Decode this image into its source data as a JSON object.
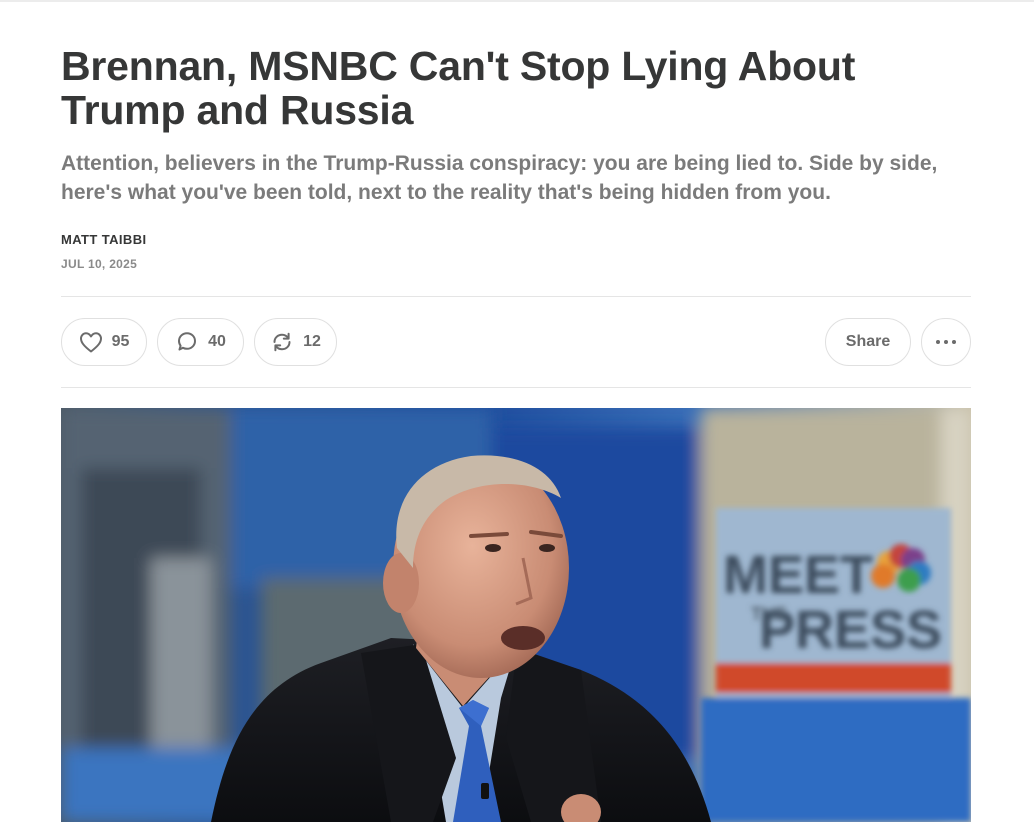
{
  "article": {
    "title": "Brennan, MSNBC Can't Stop Lying About Trump and Russia",
    "subtitle": "Attention, believers in the Trump-Russia conspiracy: you are being lied to. Side by side, here's what you've been told, next to the reality that's being hidden from you.",
    "author": "MATT TAIBBI",
    "date": "JUL 10, 2025"
  },
  "actions": {
    "likes": "95",
    "comments": "40",
    "restacks": "12",
    "share_label": "Share"
  },
  "hero": {
    "sign_text_1": "MEET",
    "sign_text_2": "THE",
    "sign_text_3": "PRESS"
  },
  "icons": {
    "like": "heart-icon",
    "comment": "comment-bubble-icon",
    "restack": "restack-arrows-icon",
    "more": "ellipsis-icon"
  }
}
